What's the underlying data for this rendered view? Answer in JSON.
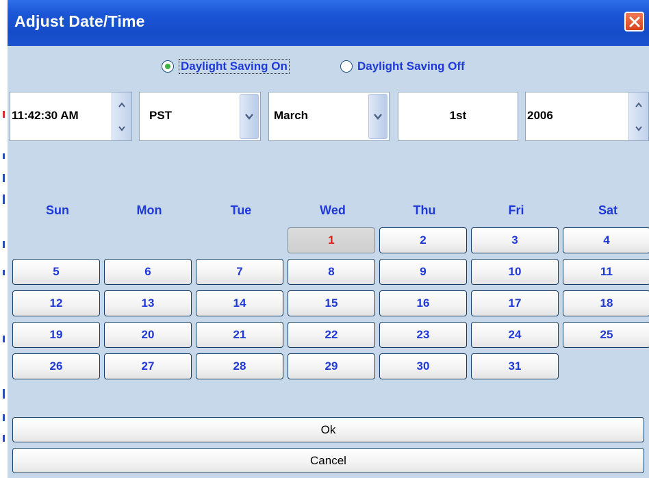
{
  "dialog": {
    "title": "Adjust Date/Time"
  },
  "daylight": {
    "on_label": "Daylight Saving On",
    "off_label": "Daylight Saving Off",
    "selected": "on"
  },
  "controls": {
    "time": "11:42:30 AM",
    "timezone": "PST",
    "month": "March",
    "day": "1st",
    "year": "2006"
  },
  "calendar": {
    "weekdays": [
      "Sun",
      "Mon",
      "Tue",
      "Wed",
      "Thu",
      "Fri",
      "Sat"
    ],
    "days": [
      "1",
      "2",
      "3",
      "4",
      "5",
      "6",
      "7",
      "8",
      "9",
      "10",
      "11",
      "12",
      "13",
      "14",
      "15",
      "16",
      "17",
      "18",
      "19",
      "20",
      "21",
      "22",
      "23",
      "24",
      "25",
      "26",
      "27",
      "28",
      "29",
      "30",
      "31"
    ],
    "selected_day": "1"
  },
  "buttons": {
    "ok": "Ok",
    "cancel": "Cancel"
  },
  "colors": {
    "titlebar": "#1b56d6",
    "background": "#c6d8ea",
    "day_text": "#1f39d8",
    "selected_day_text": "#e41b1b",
    "radio_dot": "#3fb042"
  }
}
